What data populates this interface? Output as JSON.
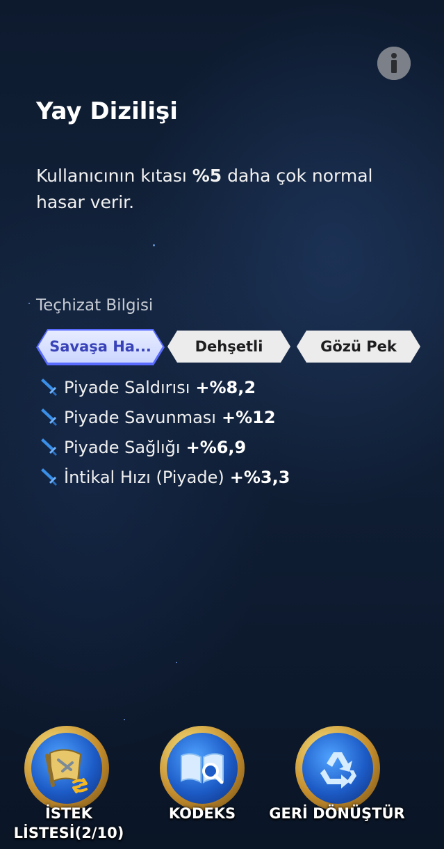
{
  "header": {
    "info_icon": "info-icon"
  },
  "formation": {
    "title": "Yay Dizilişi",
    "description_prefix": "Kullanıcının kıtası ",
    "description_value": "%5",
    "description_suffix": " daha çok normal hasar verir."
  },
  "equipment": {
    "section_label": "Teçhizat Bilgisi",
    "tabs": [
      {
        "label": "Savaşa Ha...",
        "active": true
      },
      {
        "label": "Dehşetli",
        "active": false
      },
      {
        "label": "Gözü Pek",
        "active": false
      }
    ],
    "stats": [
      {
        "label": "Piyade Saldırısı",
        "value": "+%8,2",
        "icon": "sword-icon"
      },
      {
        "label": "Piyade Savunması",
        "value": "+%12",
        "icon": "sword-icon"
      },
      {
        "label": "Piyade Sağlığı",
        "value": "+%6,9",
        "icon": "sword-icon"
      },
      {
        "label": "İntikal Hızı (Piyade)",
        "value": "+%3,3",
        "icon": "sword-icon"
      }
    ]
  },
  "bottom_bar": {
    "wishlist": {
      "label_line1": "İSTEK",
      "label_line2": "LİSTESİ(2/10)",
      "icon": "wishlist-scroll-icon"
    },
    "codex": {
      "label": "KODEKS",
      "icon": "book-search-icon"
    },
    "recycle": {
      "label": "GERİ DÖNÜŞTÜR",
      "icon": "recycle-icon"
    }
  },
  "colors": {
    "background": "#12223a",
    "active_tab_text": "#3943b8",
    "active_tab_border": "#5a6cff",
    "icon_blue": "#3a8fe8",
    "ring_gold": "#d9a640"
  }
}
